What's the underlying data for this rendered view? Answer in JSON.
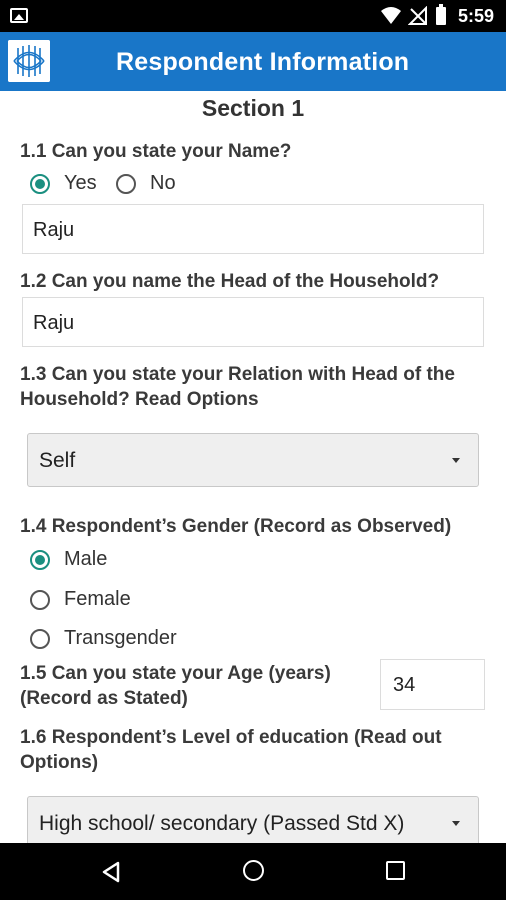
{
  "status_bar": {
    "time": "5:59"
  },
  "app_bar": {
    "title": "Respondent Information"
  },
  "section": {
    "title": "Section 1"
  },
  "q1_1": {
    "label": "1.1 Can you state your Name?",
    "options": [
      "Yes",
      "No"
    ],
    "selected": "Yes",
    "value": "Raju"
  },
  "q1_2": {
    "label": "1.2 Can you name the Head of the Household?",
    "value": "Raju"
  },
  "q1_3": {
    "label_line1": "1.3 Can you state your Relation with Head of the",
    "label_line2": "Household? Read Options",
    "selected": "Self"
  },
  "q1_4": {
    "label": "1.4 Respondent’s Gender (Record as Observed)",
    "options": [
      "Male",
      "Female",
      "Transgender"
    ],
    "selected": "Male"
  },
  "q1_5": {
    "label_line1": "1.5 Can you state your Age (years)",
    "label_line2": "(Record as Stated)",
    "value": "34"
  },
  "q1_6": {
    "label_line1": "1.6 Respondent’s Level of education (Read out",
    "label_line2": "Options)",
    "selected": "High school/ secondary (Passed Std X)"
  },
  "accent_color": "#1976c8",
  "radio_color": "#1a8f80"
}
